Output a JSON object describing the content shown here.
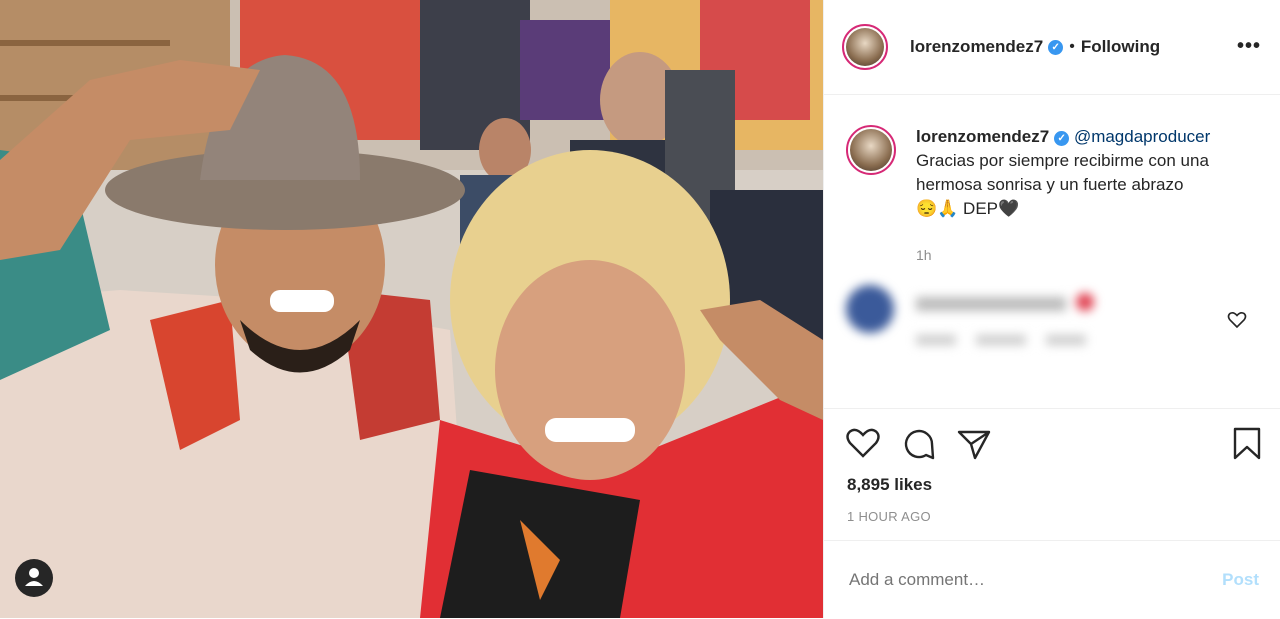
{
  "post": {
    "username": "lorenzomendez7",
    "verified_symbol": "✓",
    "separator": "•",
    "follow_status": "Following",
    "more_label": "•••"
  },
  "caption": {
    "username": "lorenzomendez7",
    "mention": "@magdaproducer",
    "text": "Gracias por siempre recibirme con una hermosa sonrisa y un fuerte abrazo",
    "emoji_line": "😔🙏 DEP🖤",
    "time": "1h"
  },
  "stats": {
    "likes": "8,895 likes",
    "posted": "1 HOUR AGO"
  },
  "comment_box": {
    "placeholder": "Add a comment…",
    "post_label": "Post"
  },
  "icons": [
    "heart-icon",
    "comment-icon",
    "share-icon",
    "bookmark-icon",
    "more-icon",
    "user-tag-icon"
  ],
  "colors": {
    "accent": "#3897f0",
    "post_disabled": "#b2dffc",
    "muted": "#8e8e8e",
    "ring": "#d62976"
  }
}
